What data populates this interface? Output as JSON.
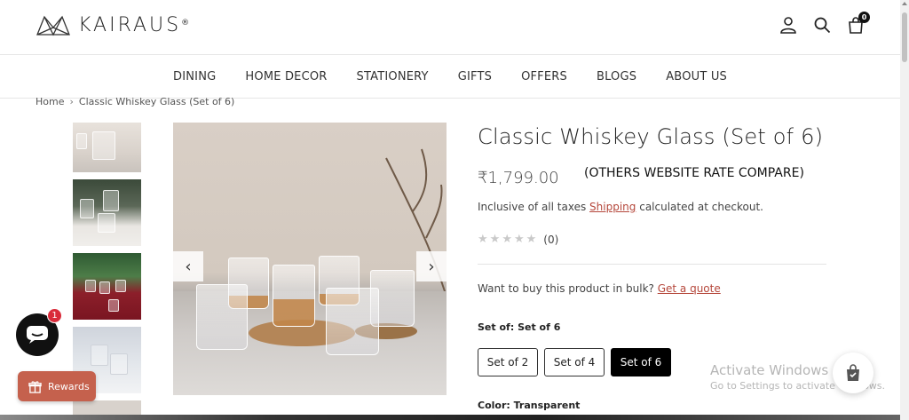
{
  "brand": {
    "name": "KAIRAUS",
    "reg": "®"
  },
  "header": {
    "cart_count": "0",
    "icons": [
      "user-icon",
      "search-icon",
      "cart-icon"
    ]
  },
  "nav": [
    "DINING",
    "HOME DECOR",
    "STATIONERY",
    "GIFTS",
    "OFFERS",
    "BLOGS",
    "ABOUT US"
  ],
  "breadcrumb": {
    "home": "Home",
    "current": "Classic Whiskey Glass (Set of 6)"
  },
  "product": {
    "title": "Classic Whiskey Glass (Set of 6)",
    "price": "₹1,799.00",
    "compare_note": "(OTHERS WEBSITE RATE COMPARE)",
    "tax_prefix": "Inclusive of all taxes",
    "tax_link": "Shipping",
    "tax_suffix": "calculated at checkout.",
    "rating_stars": 0,
    "rating_count": "(0)",
    "bulk_text": "Want to buy this product in bulk?",
    "bulk_link": "Get a quote",
    "set_label": "Set of:",
    "set_selected": "Set of 6",
    "set_options": [
      "Set of 2",
      "Set of 4",
      "Set of 6"
    ],
    "color_label": "Color:",
    "color_value": "Transparent"
  },
  "carousel": {
    "prev": "‹",
    "next": "›"
  },
  "widgets": {
    "chat_badge": "1",
    "rewards_label": "Rewards",
    "watermark_line1": "Activate Windows",
    "watermark_line2": "Go to Settings to activate Windows."
  },
  "colors": {
    "accent_link": "#b5473b",
    "rewards_bg": "#c5614d",
    "active_btn": "#000000"
  }
}
